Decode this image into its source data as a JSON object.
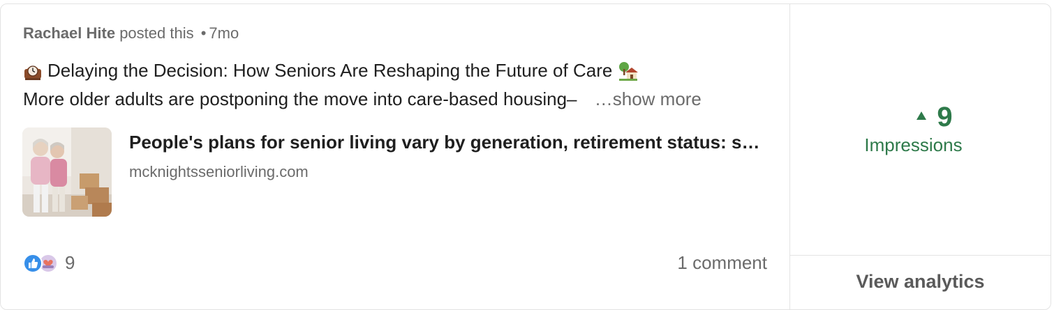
{
  "post": {
    "author": "Rachael Hite",
    "action": "posted this",
    "separator": "•",
    "age": "7mo",
    "headline": "Delaying the Decision: How Seniors Are Reshaping the Future of Care",
    "headline_prefix_icon": "mantelpiece-clock-icon",
    "headline_suffix_icon": "house-with-garden-icon",
    "body_preview": "More older adults are postponing the move into care-based housing–",
    "show_more_label": "…show more"
  },
  "link_preview": {
    "title": "People's plans for senior living vary by generation, retirement status: survey",
    "domain": "mcknightsseniorliving.com",
    "thumbnail_icon": "article-thumbnail-photo"
  },
  "engagement": {
    "reaction_icons": [
      "like-icon",
      "love-icon"
    ],
    "reaction_count": "9",
    "comments_label": "1 comment"
  },
  "analytics": {
    "impressions_value": "9",
    "impressions_label": "Impressions",
    "trend_icon": "up-triangle-icon",
    "view_label": "View analytics",
    "accent_color": "#2e7a4a"
  }
}
